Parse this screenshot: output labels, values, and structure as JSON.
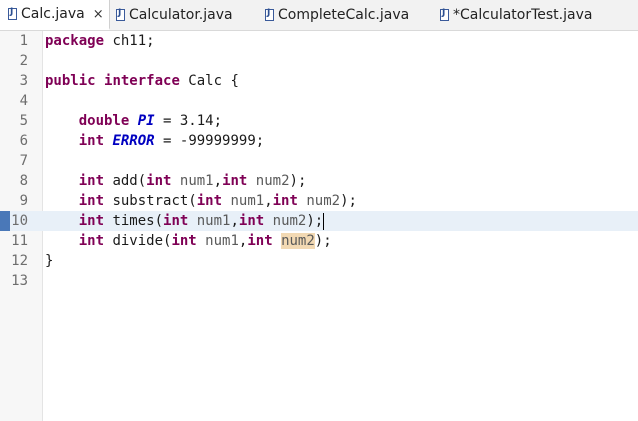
{
  "tabs": [
    {
      "label": "Calc.java",
      "close": "×",
      "active": true
    },
    {
      "label": "Calculator.java",
      "active": false
    },
    {
      "label": "CompleteCalc.java",
      "active": false
    },
    {
      "label": "*CalculatorTest.java",
      "active": false
    }
  ],
  "editor": {
    "line_numbers": [
      "1",
      "2",
      "3",
      "4",
      "5",
      "6",
      "7",
      "8",
      "9",
      "10",
      "11",
      "12",
      "13"
    ],
    "lines": {
      "l1": {
        "kw": "package",
        "rest": " ch11;"
      },
      "l3": {
        "kw1": "public",
        "kw2": "interface",
        "rest": " Calc {"
      },
      "l5": {
        "kw": "double",
        "name": "PI",
        "rest": " = 3.14;"
      },
      "l6": {
        "kw": "int",
        "name": "ERROR",
        "rest": " = -99999999;"
      },
      "l8": {
        "kw": "int",
        "method": " add(",
        "p1kw": "int",
        "p1": " num1",
        "p2kw": "int",
        "p2": " num2",
        "end": ");"
      },
      "l9": {
        "kw": "int",
        "method": " substract(",
        "p1kw": "int",
        "p1": " num1",
        "p2kw": "int",
        "p2": " num2",
        "end": ");"
      },
      "l10": {
        "kw": "int",
        "method": " times(",
        "p1kw": "int",
        "p1": " num1",
        "p2kw": "int",
        "p2": " num2",
        "end": ");"
      },
      "l11": {
        "kw": "int",
        "method": " divide(",
        "p1kw": "int",
        "p1": " num1",
        "p2kw": "int",
        "p2": "num2",
        "end": ");"
      },
      "l12": {
        "rest": "}"
      }
    },
    "current_line": 10
  }
}
